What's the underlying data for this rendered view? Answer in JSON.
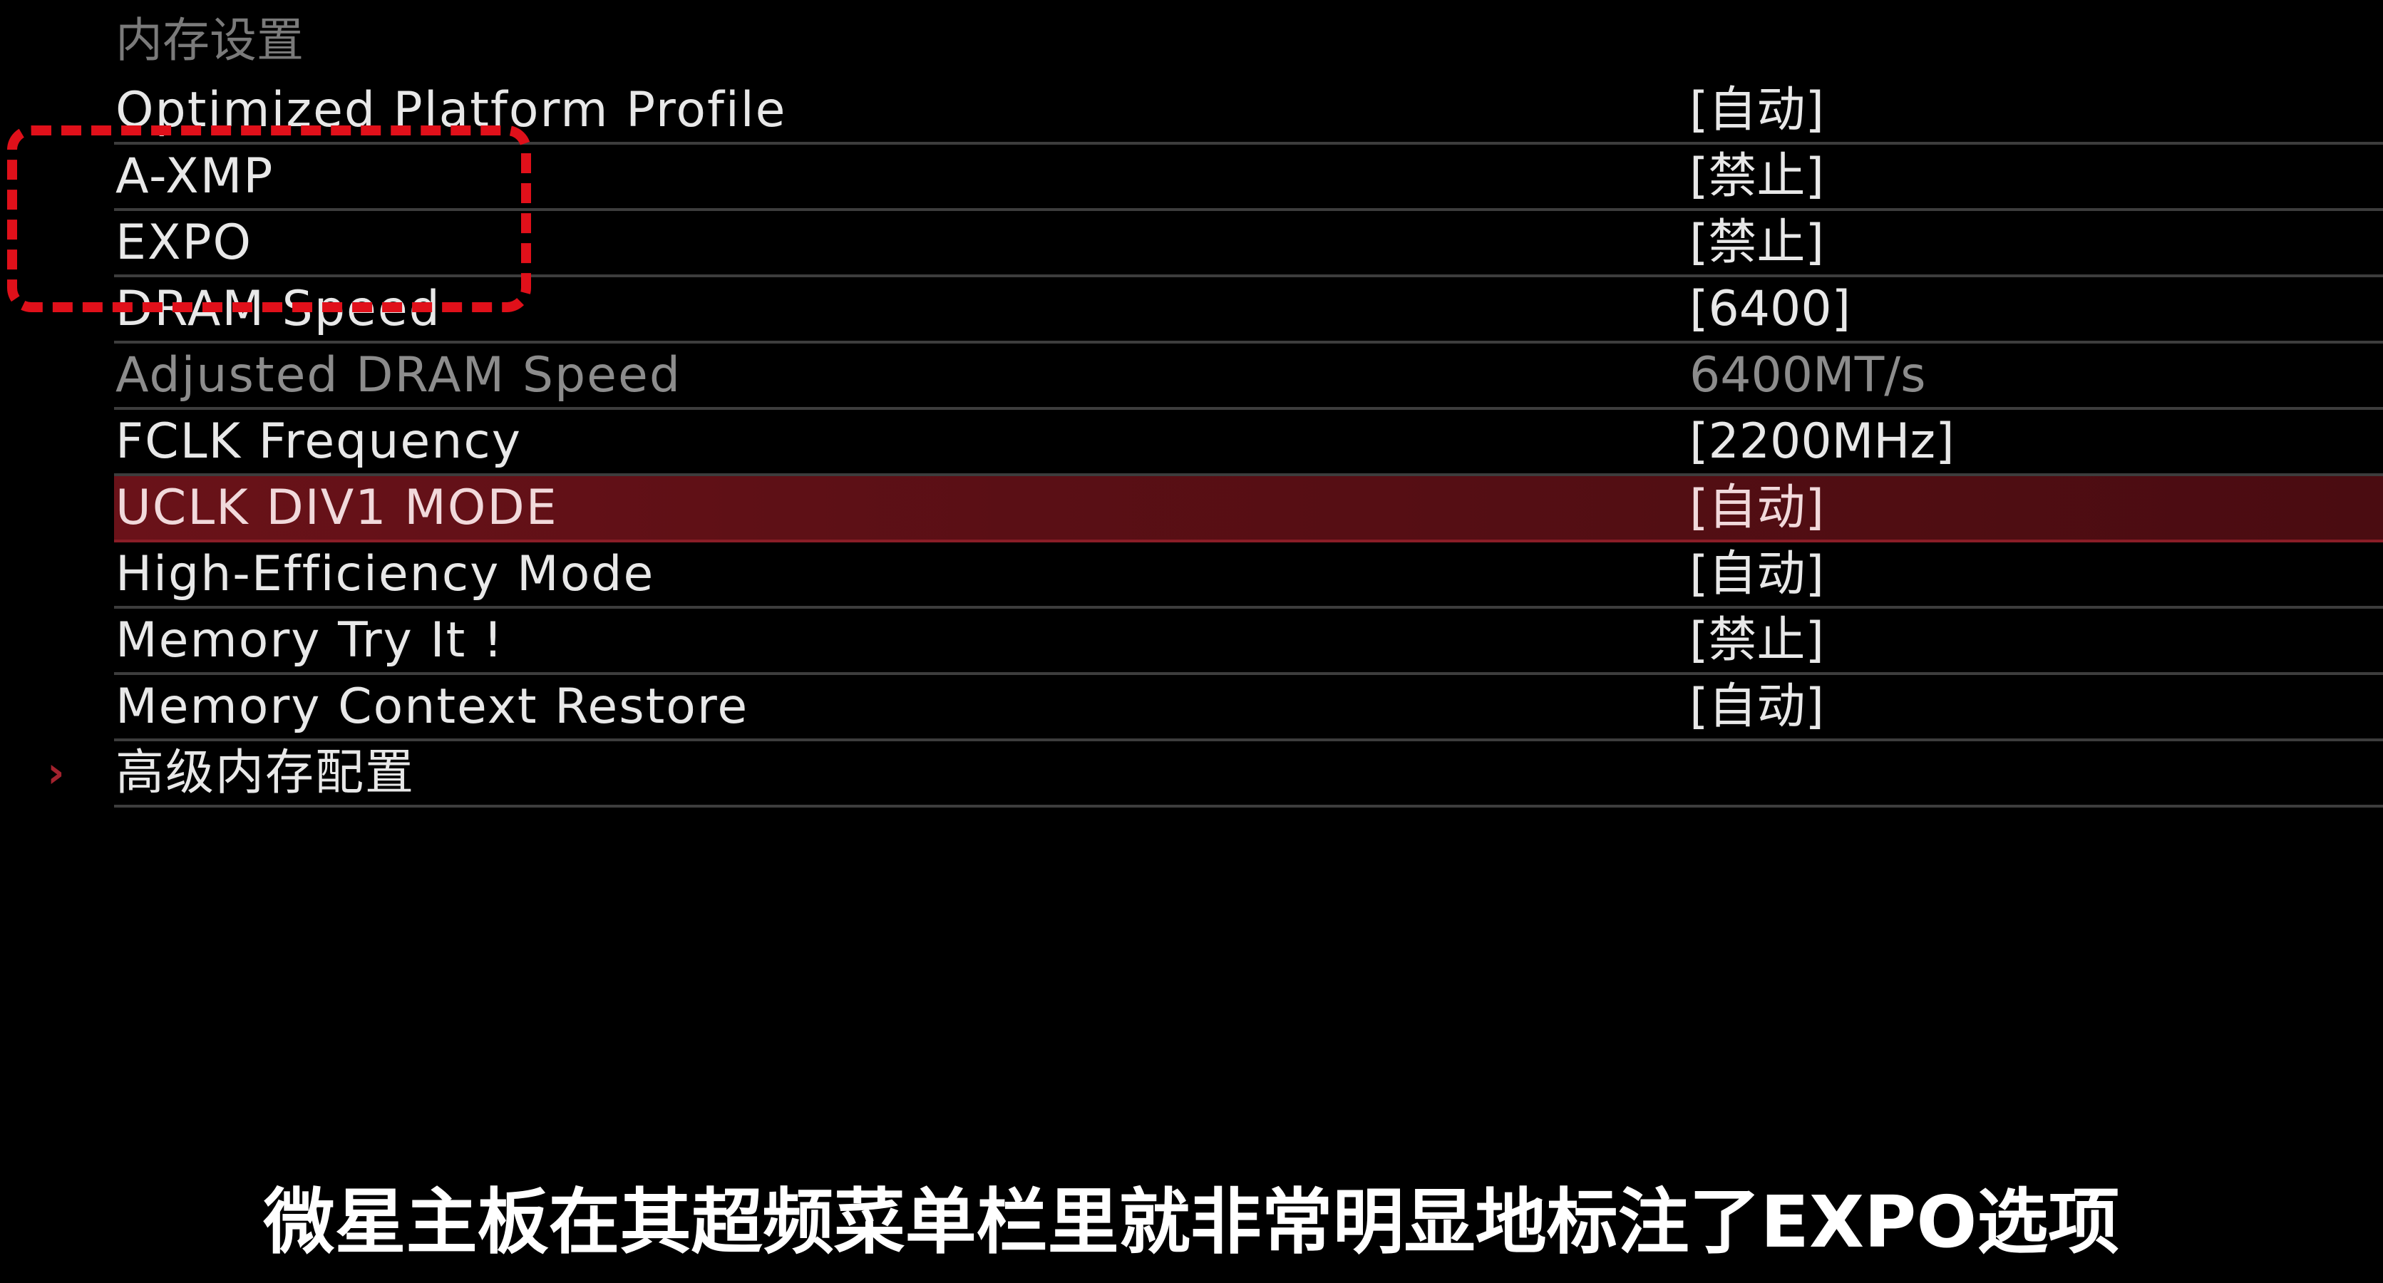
{
  "section": {
    "title": "内存设置"
  },
  "rows": [
    {
      "label": "Optimized Platform Profile",
      "value": "[自动]",
      "state": "normal"
    },
    {
      "label": "A-XMP",
      "value": "[禁止]",
      "state": "normal"
    },
    {
      "label": "EXPO",
      "value": "[禁止]",
      "state": "normal"
    },
    {
      "label": "DRAM Speed",
      "value": "[6400]",
      "state": "normal"
    },
    {
      "label": "Adjusted DRAM Speed",
      "value": "6400MT/s",
      "state": "disabled"
    },
    {
      "label": "FCLK Frequency",
      "value": "[2200MHz]",
      "state": "normal"
    },
    {
      "label": "UCLK DIV1 MODE",
      "value": "[自动]",
      "state": "selected"
    },
    {
      "label": "High-Efficiency Mode",
      "value": "[自动]",
      "state": "normal"
    },
    {
      "label": "Memory Try It !",
      "value": "[禁止]",
      "state": "normal"
    },
    {
      "label": "Memory Context Restore",
      "value": "[自动]",
      "state": "normal"
    },
    {
      "label": "高级内存配置",
      "value": "",
      "state": "submenu"
    }
  ],
  "submenu_arrow": "›",
  "caption": "微星主板在其超频菜单栏里就非常明显地标注了EXPO选项",
  "colors": {
    "background": "#000000",
    "selected_row": "#5a0f15",
    "accent_red": "#a3222e",
    "annotation_red": "#e0101a",
    "disabled_text": "#8c8c8c"
  }
}
